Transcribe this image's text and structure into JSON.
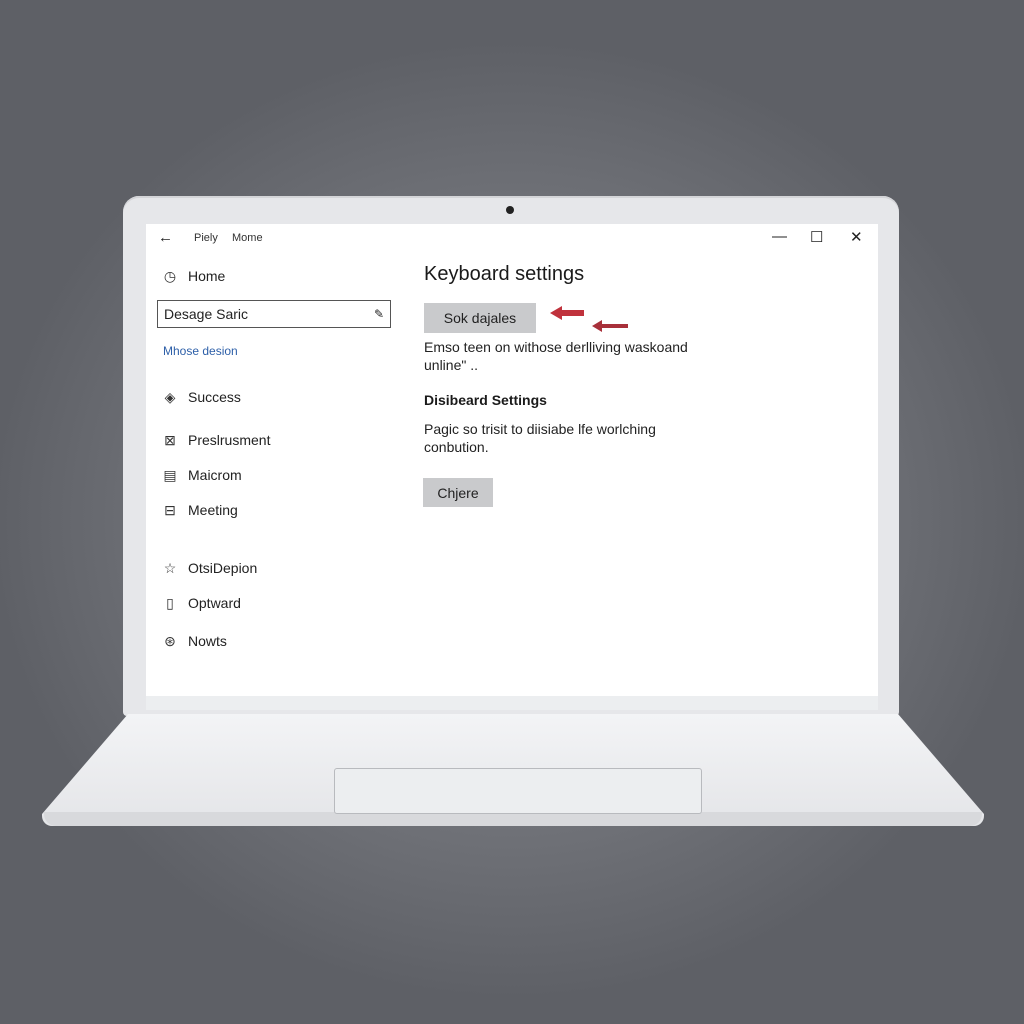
{
  "window": {
    "back_icon": "←",
    "title_part1": "Piely",
    "title_part2": "Mome",
    "minimize_icon": "—",
    "maximize_icon": "☐",
    "close_icon": "✕"
  },
  "sidebar": {
    "home": {
      "label": "Home",
      "icon": "clock-icon",
      "glyph": "◷"
    },
    "search": {
      "value": "Desage Saric",
      "edit_icon": "✎"
    },
    "link": "Mhose desion",
    "items": [
      {
        "label": "Success",
        "icon": "diamond-icon",
        "glyph": "◈"
      },
      {
        "label": "Preslrusment",
        "icon": "grid-icon",
        "glyph": "⊠"
      },
      {
        "label": "Maicrom",
        "icon": "calendar-icon",
        "glyph": "▤"
      },
      {
        "label": "Meeting",
        "icon": "board-icon",
        "glyph": "⊟"
      },
      {
        "label": "OtsiDepion",
        "icon": "star-icon",
        "glyph": "☆"
      },
      {
        "label": "Optward",
        "icon": "clipboard-icon",
        "glyph": "▯"
      },
      {
        "label": "Nowts",
        "icon": "globe-icon",
        "glyph": "⊛"
      }
    ]
  },
  "main": {
    "title": "Keyboard settings",
    "primary_button": "Sok dajales",
    "description": "Emso teen on withose derlliving waskoand unline\" ..",
    "section_heading": "Disibeard Settings",
    "section_description": "Pagic so trisit to diisiabe lfe worlching conbution.",
    "secondary_button": "Chjere"
  },
  "colors": {
    "arrow": "#c0323c",
    "link": "#2d5fa8",
    "button_bg": "#c9cacc"
  }
}
